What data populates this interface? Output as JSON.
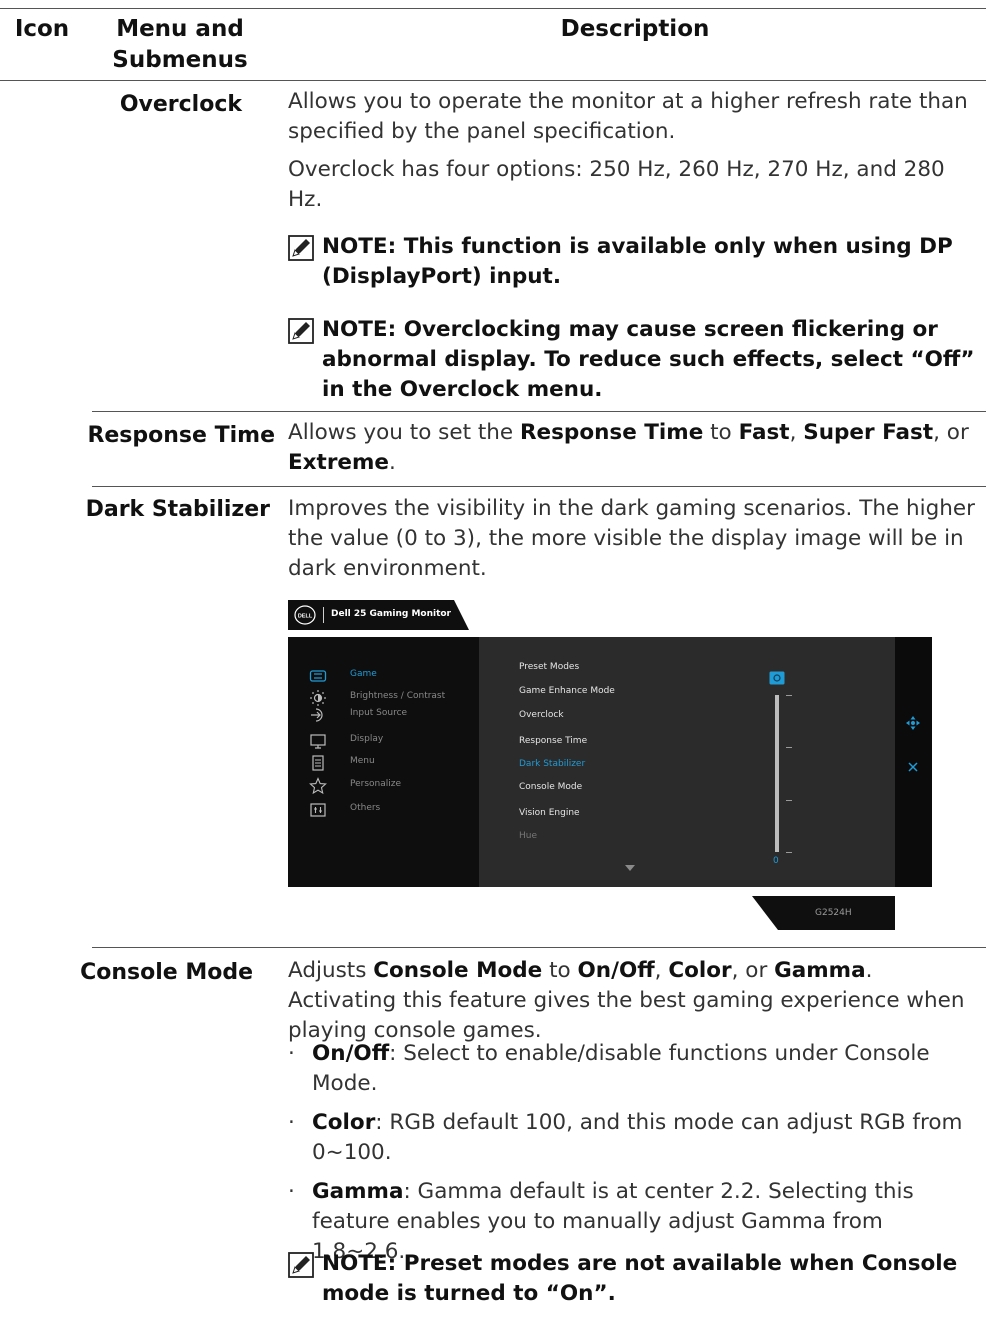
{
  "table": {
    "headers": {
      "icon": "Icon",
      "menu": "Menu and Submenus",
      "description": "Description"
    }
  },
  "rows": {
    "overclock": {
      "name": "Overclock",
      "desc1": "Allows you to operate the monitor at a higher refresh rate than specified by the panel specification.",
      "desc2": "Overclock has four options: 250 Hz, 260 Hz, 270 Hz, and 280 Hz.",
      "note1": "NOTE: This function is available only when using DP (DisplayPort) input.",
      "note2": "NOTE: Overclocking may cause screen flickering or abnormal display. To reduce such effects, select “Off” in the Overclock menu."
    },
    "response_time": {
      "name": "Response Time",
      "t1": "Allows you to set the ",
      "b1": "Response Time",
      "t2": " to ",
      "b2": "Fast",
      "t3": ", ",
      "b3": "Super Fast",
      "t4": ", or ",
      "b4": "Extreme",
      "t5": "."
    },
    "dark_stabilizer": {
      "name": "Dark Stabilizer",
      "desc": "Improves the visibility in the dark gaming scenarios. The higher the value (0 to 3), the more visible the display image will be in dark environment."
    },
    "console_mode": {
      "name": "Console Mode",
      "t1": "Adjusts ",
      "b1": "Console Mode",
      "t2": " to ",
      "b2": "On/Off",
      "t3": ", ",
      "b3": "Color",
      "t4": ", or ",
      "b4": "Gamma",
      "t5": ". Activating this feature gives the best gaming experience when playing console games.",
      "bullets": [
        {
          "label": "On/Off",
          "text": ": Select to enable/disable functions under Console Mode."
        },
        {
          "label": "Color",
          "text": ": RGB default 100, and this mode can adjust RGB from 0~100."
        },
        {
          "label": "Gamma",
          "text": ": Gamma default is at center 2.2. Selecting this feature enables you to manually adjust Gamma from 1.8~2.6."
        }
      ],
      "note": "NOTE: Preset modes are not available when Console mode is turned to “On”."
    }
  },
  "osd": {
    "brand": "DELL",
    "title": "Dell 25 Gaming Monitor",
    "left_menu": [
      "Game",
      "Brightness / Contrast",
      "Input Source",
      "Display",
      "Menu",
      "Personalize",
      "Others"
    ],
    "left_icons": [
      "game-icon",
      "brightness-icon",
      "input-source-icon",
      "display-icon",
      "menu-icon",
      "star-icon",
      "others-icon"
    ],
    "mid_menu": [
      "Preset Modes",
      "Game Enhance Mode",
      "Overclock",
      "Response Time",
      "Dark Stabilizer",
      "Console Mode",
      "Vision Engine",
      "Hue"
    ],
    "selected_left": "Game",
    "selected_mid": "Dark Stabilizer",
    "slider_value": "0",
    "model": "G2524H",
    "colors": {
      "accent": "#1f9bd6",
      "panel": "#2b2b2b",
      "disabled": "#777777"
    }
  }
}
